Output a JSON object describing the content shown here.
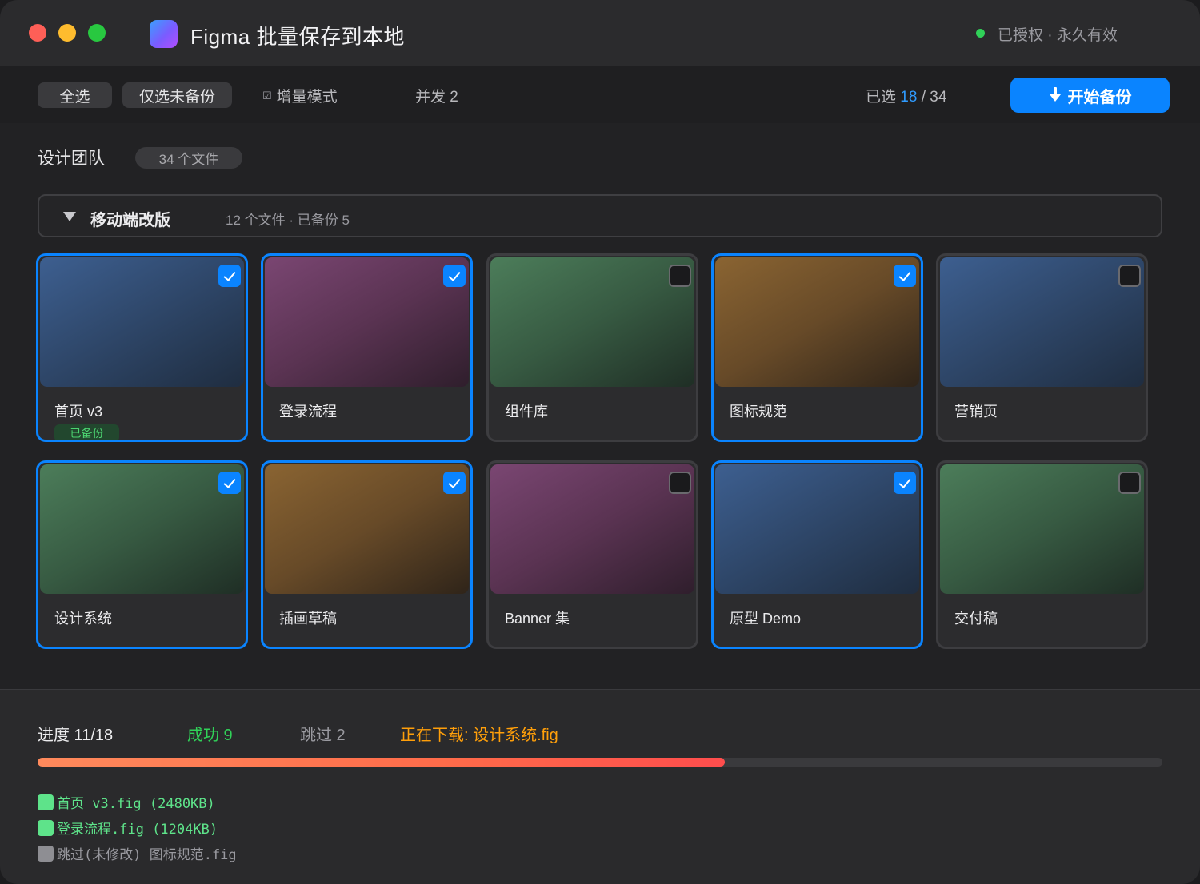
{
  "titlebar": {
    "app_title": "Figma 批量保存到本地",
    "license_status": "已授权 · 永久有效",
    "license_color": "#30d158"
  },
  "toolbar": {
    "select_all_label": "全选",
    "select_unbacked_label": "仅选未备份",
    "incremental_icon": "☑",
    "incremental_label": "增量模式",
    "concurrency_label": "并发 2",
    "selected_prefix": "已选",
    "selected_count": "18",
    "selected_sep": "/",
    "total_count": "34",
    "start_button_label": "开始备份",
    "accent_color": "#0a84ff"
  },
  "team": {
    "name": "设计团队",
    "file_count_label": "34 个文件"
  },
  "folder": {
    "name": "移动端改版",
    "meta": "12 个文件 · 已备份 5",
    "files": [
      {
        "name": "首页 v3",
        "selected": true,
        "badge": "已备份",
        "gradient": "blue"
      },
      {
        "name": "登录流程",
        "selected": true,
        "badge": "",
        "gradient": "purple"
      },
      {
        "name": "组件库",
        "selected": false,
        "badge": "",
        "gradient": "green"
      },
      {
        "name": "图标规范",
        "selected": true,
        "badge": "",
        "gradient": "orange"
      },
      {
        "name": "营销页",
        "selected": false,
        "badge": "",
        "gradient": "blue"
      },
      {
        "name": "设计系统",
        "selected": true,
        "badge": "",
        "gradient": "green"
      },
      {
        "name": "插画草稿",
        "selected": true,
        "badge": "",
        "gradient": "orange"
      },
      {
        "name": "Banner 集",
        "selected": false,
        "badge": "",
        "gradient": "purple"
      },
      {
        "name": "原型 Demo",
        "selected": true,
        "badge": "",
        "gradient": "blue"
      },
      {
        "name": "交付稿",
        "selected": false,
        "badge": "",
        "gradient": "green"
      }
    ]
  },
  "progress": {
    "label": "进度 11/18",
    "done": 11,
    "total": 18,
    "fill_fraction": 0.611,
    "success_label": "成功 9",
    "skip_label": "跳过 2",
    "current_label": "正在下载: 设计系统.fig"
  },
  "log": [
    {
      "status": "ok",
      "text": "首页 v3.fig (2480KB)"
    },
    {
      "status": "ok",
      "text": "登录流程.fig (1204KB)"
    },
    {
      "status": "skip",
      "text": "跳过(未修改) 图标规范.fig"
    }
  ]
}
